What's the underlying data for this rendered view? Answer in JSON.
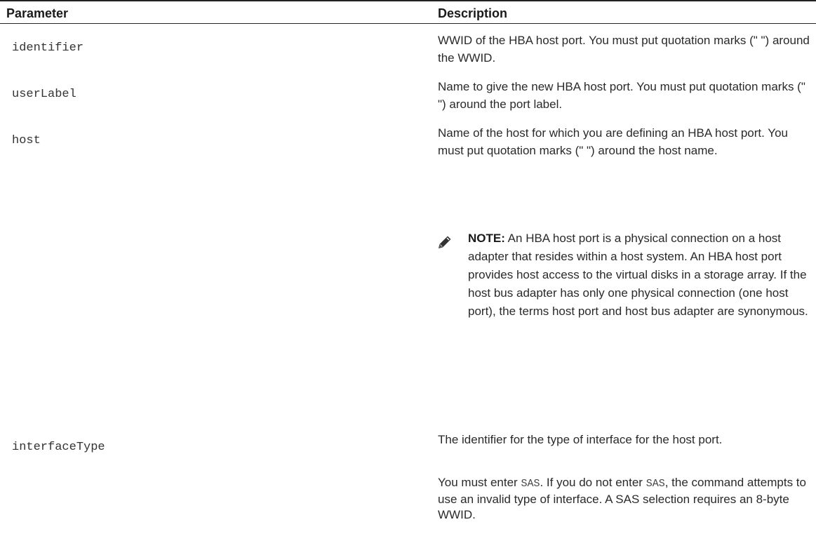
{
  "header": {
    "parameter": "Parameter",
    "description": "Description"
  },
  "rows": [
    {
      "parameter": "identifier",
      "description": "WWID of the HBA host port. You must put quotation marks (\" \") around the WWID."
    },
    {
      "parameter": "userLabel",
      "description": "Name to give the new HBA host port. You must put quotation marks (\" \") around the port label."
    },
    {
      "parameter": "host",
      "description": "Name of the host for which you are defining an HBA host port. You must put quotation marks (\" \") around the host name.",
      "note_label": "NOTE:",
      "note_text": " An HBA host port is a physical connection on a host adapter that resides within a host system. An HBA host port provides host access to the virtual disks in a storage array. If the host bus adapter has only one physical connection (one host port), the terms host port and host bus adapter are synonymous.",
      "note_icon": "pencil-note-icon"
    },
    {
      "parameter": "interfaceType",
      "description": "The identifier for the type of interface for the host port.",
      "extra_1": "You must enter ",
      "extra_code_1": "SAS",
      "extra_2": ". If you do not enter ",
      "extra_code_2": "SAS",
      "extra_3": ", the command attempts to use an invalid type of interface. A SAS selection requires an 8-byte WWID."
    }
  ]
}
